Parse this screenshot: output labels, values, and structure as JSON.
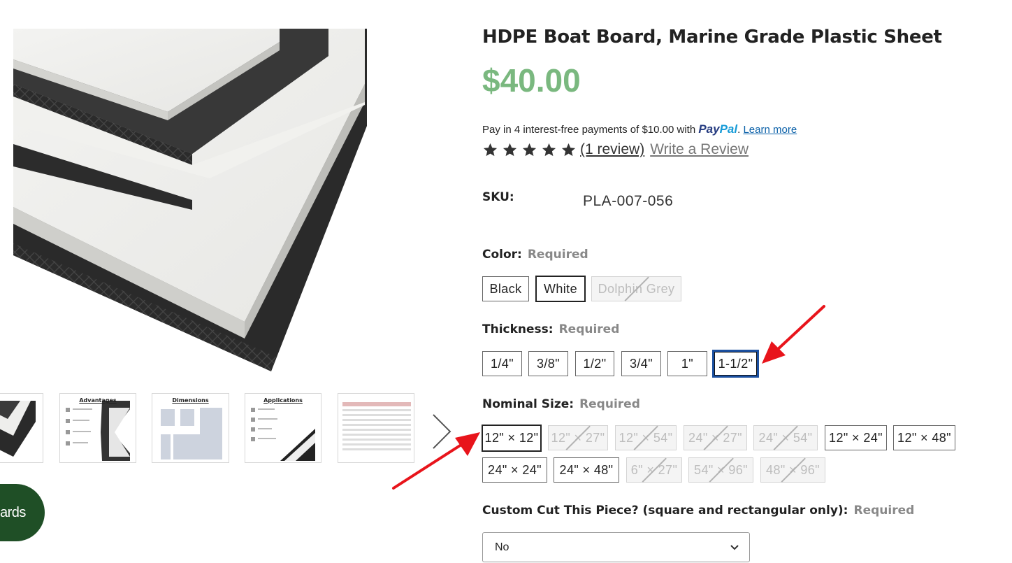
{
  "product": {
    "title": "HDPE Boat Board, Marine Grade Plastic Sheet",
    "price": "$40.00",
    "paypal_text": "Pay in 4 interest-free payments of $10.00 with",
    "paypal_logo_part1": "Pay",
    "paypal_logo_part2": "Pal",
    "paypal_period": ".",
    "paypal_learn_more": "Learn more",
    "rating_stars": 5,
    "review_link": "(1 review)",
    "write_review": "Write a Review",
    "sku_label": "SKU:",
    "sku_value": "PLA-007-056"
  },
  "options": {
    "required_text": "Required",
    "color": {
      "label": "Color:",
      "values": [
        {
          "label": "Black",
          "state": "available"
        },
        {
          "label": "White",
          "state": "selected"
        },
        {
          "label": "Dolphin Grey",
          "state": "unavailable"
        }
      ]
    },
    "thickness": {
      "label": "Thickness:",
      "values": [
        {
          "label": "1/4\"",
          "state": "available"
        },
        {
          "label": "3/8\"",
          "state": "available"
        },
        {
          "label": "1/2\"",
          "state": "available"
        },
        {
          "label": "3/4\"",
          "state": "available"
        },
        {
          "label": "1\"",
          "state": "available"
        },
        {
          "label": "1-1/2\"",
          "state": "selected"
        }
      ]
    },
    "nominal_size": {
      "label": "Nominal Size:",
      "values": [
        {
          "label": "12\" × 12\"",
          "state": "selected"
        },
        {
          "label": "12\" × 27\"",
          "state": "unavailable"
        },
        {
          "label": "12\" × 54\"",
          "state": "unavailable"
        },
        {
          "label": "24\" × 27\"",
          "state": "unavailable"
        },
        {
          "label": "24\" × 54\"",
          "state": "unavailable"
        },
        {
          "label": "12\" × 24\"",
          "state": "available"
        },
        {
          "label": "12\" × 48\"",
          "state": "available"
        },
        {
          "label": "24\" × 24\"",
          "state": "available"
        },
        {
          "label": "24\" × 48\"",
          "state": "available"
        },
        {
          "label": "6\" × 27\"",
          "state": "unavailable"
        },
        {
          "label": "54\" × 96\"",
          "state": "unavailable"
        },
        {
          "label": "48\" × 96\"",
          "state": "unavailable"
        }
      ]
    },
    "custom_cut": {
      "label": "Custom Cut This Piece? (square and rectangular only):",
      "selected_value": "No"
    }
  },
  "gallery": {
    "thumbnail_captions": [
      "Advantages",
      "Dimensions",
      "Applications"
    ],
    "next_icon": "chevron-right-icon"
  },
  "rewards_button": {
    "label": "ards"
  },
  "colors": {
    "price": "#7ab87f",
    "rewards": "#1f4f26",
    "selected_blue": "#1a4fa0",
    "annotation": "#e8141b"
  }
}
